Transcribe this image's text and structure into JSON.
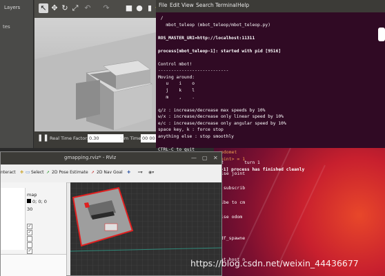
{
  "gazebo": {
    "layers_tab": "Layers",
    "side_text": "tes",
    "real_time_factor_label": "Real Time Factor:",
    "real_time_factor_value": "0.30",
    "sim_time_label": "Sim Time:",
    "sim_time_value": "00 00"
  },
  "terminal": {
    "menu": [
      "File",
      "Edit",
      "View",
      "Search",
      "Terminal",
      "Help"
    ],
    "lines": [
      " /",
      "   mbot_teleop (mbot_teleop/mbot_teleop.py)",
      "",
      "ROS_MASTER_URI=http://localhost:11311",
      "",
      "process[mbot_teleop-1]: started with pid [9516]",
      "",
      "Control mbot!",
      "---------------------------",
      "Moving around:",
      "   u    i    o",
      "   j    k    l",
      "   m    ,    .",
      "",
      "q/z : increase/decrease max speeds by 10%",
      "w/x : increase/decrease only linear speed by 10%",
      "e/c : increase/decrease only angular speed by 10%",
      "space key, k : force stop",
      "anything else : stop smoothly",
      "",
      "CTRL-C to quit",
      "",
      "currently:      speed 0.2        turn 1",
      ",iiii,,,,,,,[mbot_teleop-1] process has finished cleanly"
    ]
  },
  "background_terminal": {
    "lines": [
      "<odomet",
      "Joint> = 1",
      "",
      "tise joint",
      "",
      "o subscrib",
      "",
      "ribe to cm",
      "",
      "tise odom",
      "",
      "",
      "rdf_spawne",
      "",
      "",
      "get host n"
    ]
  },
  "rviz": {
    "title": "gmapping.rviz* - RViz",
    "toolbar": {
      "interact": "nteract",
      "select": "Select",
      "pose_estimate": "2D Pose Estimate",
      "nav_goal": "2D Nav Goal"
    },
    "panel_values": {
      "frame": "map",
      "color": "0; 0; 0",
      "rate": "30"
    },
    "checkboxes": [
      true,
      true,
      false,
      false,
      true,
      false
    ]
  },
  "watermark": "https://blog.csdn.net/weixin_44436677",
  "colors": {
    "terminal_bg": "#300a24",
    "ubuntu_titlebar": "#3c3b37",
    "robot_border": "#e02020"
  },
  "icons": [
    "select-arrow-icon",
    "translate-icon",
    "rotate-icon",
    "scale-icon",
    "undo-icon",
    "redo-icon",
    "box-shape-icon",
    "sphere-shape-icon",
    "cylinder-shape-icon",
    "sun-icon",
    "pause-icon",
    "close-icon",
    "minimize-icon",
    "maximize-icon",
    "move-camera-icon",
    "select-icon",
    "pose-estimate-icon",
    "nav-goal-icon",
    "zoom-icon",
    "eye-icon"
  ]
}
